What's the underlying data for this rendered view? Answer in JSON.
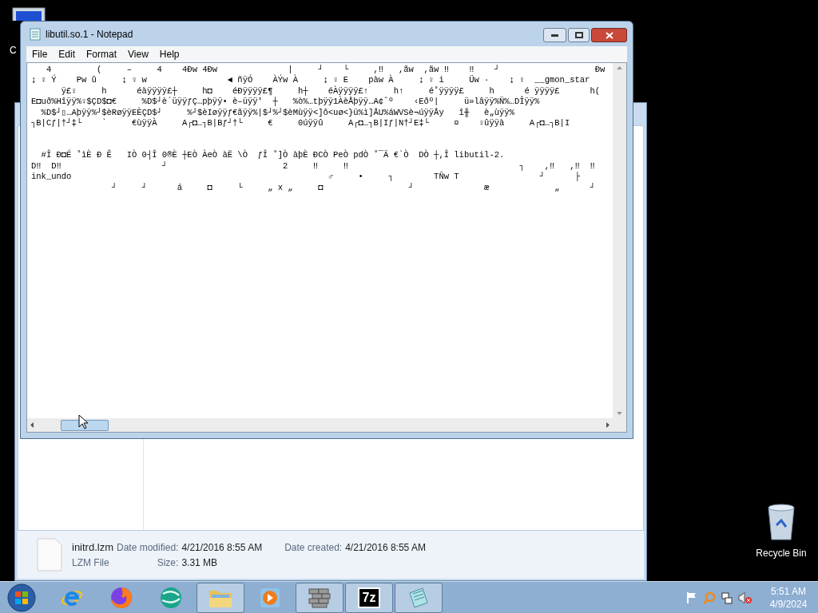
{
  "desktop_icons": [
    {
      "kind": "computer",
      "label": "C"
    },
    {
      "kind": "recycle",
      "label": "Recycle Bin"
    }
  ],
  "explorer": {
    "details": {
      "name": "initrd.lzm",
      "type": "LZM File",
      "modified_label": "Date modified:",
      "modified": "4/21/2016 8:55 AM",
      "created_label": "Date created:",
      "created": "4/21/2016 8:55 AM",
      "size_label": "Size:",
      "size": "3.31 MB"
    }
  },
  "notepad": {
    "title": "libutil.so.1 - Notepad",
    "menu": [
      "File",
      "Edit",
      "Format",
      "View",
      "Help"
    ],
    "blocks": [
      [
        "   4         (     –     4    4Đw 4Đw              |     ┘    └     ,‼   ,ãw  ,ãw ‼    ‼    ┘                   Đw",
        "↨ ♀ Ý    Pw û     ↨ ♀ w                ◄ ñÿÓ    ÀÝw À     ↨ ♀ E    pàw À     ↨ ♀ i     Üw ·    ↨ ♀  __gmon_star",
        "      ÿ£♀     h      éàÿÿÿÿ£┼     h◘    éĐÿÿÿÿ£¶     h┼    éÀÿÿÿÿ£↑     h↑     é˚ÿÿÿÿ£     h      é ÿÿÿÿ£      h(",
        "E◘uð%Hîÿÿ%♀$ÇD$◘€     %D$┘è´üÿÿƒÇ…pþÿÿ• è–üÿÿ'  ┼   %ò%…tþÿÿ1ÀèÅþÿÿ…A¢ˆº    ‹Eðº|     ü»lâÿÿ%Ñ%…DÎÿÿ%",
        "  %D$┘▯…Aþÿÿ%┘$èRøÿÿEÈÇD$┘     %┘$èIøÿÿƒ€ãÿÿ%|$┘%┘$èMùÿÿ<]ô<uø<}ü%ì]ÅU%áWVSè¬úÿÿÅy   î╫   è„ùÿÿ%",
        "┐B|Cƒ|†┘‡└    `     €ùÿÿÀ     A┌◘…┐B|Bƒ┘†└     €     0úÿÿû     A┌◘…┐B|Iƒ|N†┘E‡└     ¤    ♀ûÿÿà     A┌◘…┐B|I"
      ],
      [
        "  #Î Đ◘É ˚ìÈ Đ Ê   IÒ 0┤Î 0®È ┼EÒ ÀeÒ àË \\Ò  ƒÎ ˚]Ò àþÈ ĐCÒ PeÒ pdÒ ˚¯Ä €`Ò  DÒ ┼,Î libutil-2.",
        "D‼  D‼                    ┘                       2     ‼     ‼                                  ┐    ,‼   ,‼  ‼",
        "ink_undo                                                   ♂     •     ┐        TÑw T                ┘      ├",
        "                ┘     ┘      á     ◘     └     „ x „     ◘                 ┘              æ             „      ┘"
      ]
    ]
  },
  "taskbar": {
    "buttons": [
      {
        "kind": "ie",
        "running": false
      },
      {
        "kind": "firefox",
        "running": false
      },
      {
        "kind": "globe",
        "running": false
      },
      {
        "kind": "folder",
        "running": true
      },
      {
        "kind": "media",
        "running": false
      },
      {
        "kind": "bricks",
        "running": true
      },
      {
        "kind": "sevenzip",
        "running": true,
        "label": "7z"
      },
      {
        "kind": "notepad",
        "running": true
      }
    ],
    "clock": {
      "time": "5:51 AM",
      "date": "4/9/2024"
    }
  }
}
